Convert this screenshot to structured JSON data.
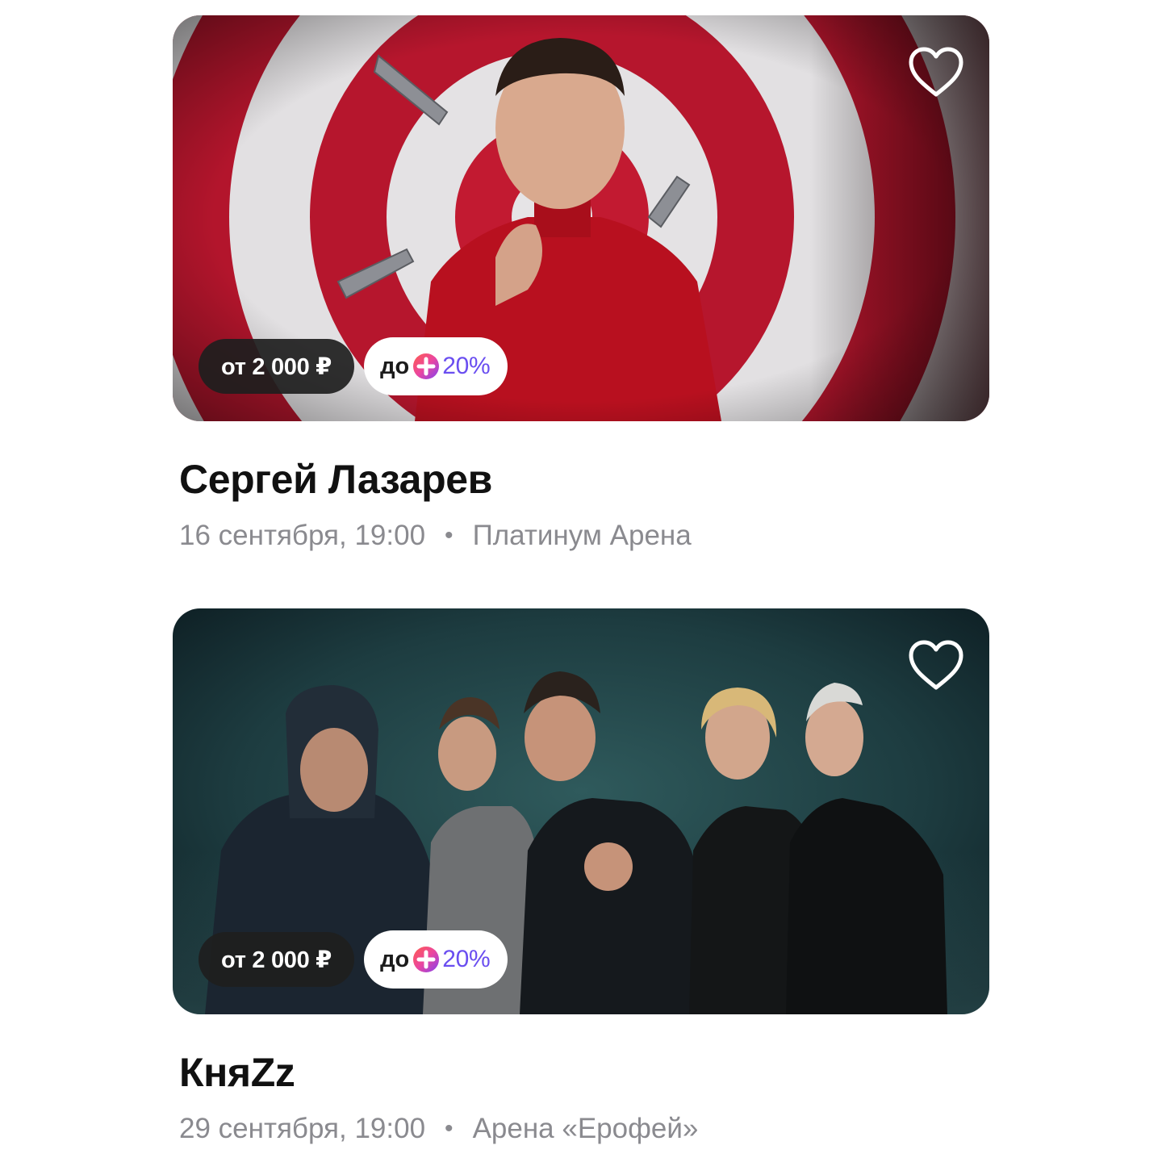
{
  "events": [
    {
      "title": "Сергей Лазарев",
      "date": "16 сентября, 19:00",
      "separator": "•",
      "venue": "Платинум Арена",
      "price": "от 2 000 ₽",
      "plus_prefix": "до",
      "plus_value": "20%",
      "favorite": false
    },
    {
      "title": "КняZz",
      "date": "29 сентября, 19:00",
      "separator": "•",
      "venue": "Арена «Ерофей»",
      "price": "от 2 000 ₽",
      "plus_prefix": "до",
      "plus_value": "20%",
      "favorite": false
    }
  ],
  "icons": {
    "favorite": "heart-outline-icon",
    "plus": "yandex-plus-icon"
  },
  "colors": {
    "plus_accent": "#6a4ef0",
    "plus_gradient_start": "#ff5c4d",
    "plus_gradient_end": "#8341ef",
    "price_badge_bg": "#1e1e1e",
    "meta_text": "#8a8a8f"
  }
}
